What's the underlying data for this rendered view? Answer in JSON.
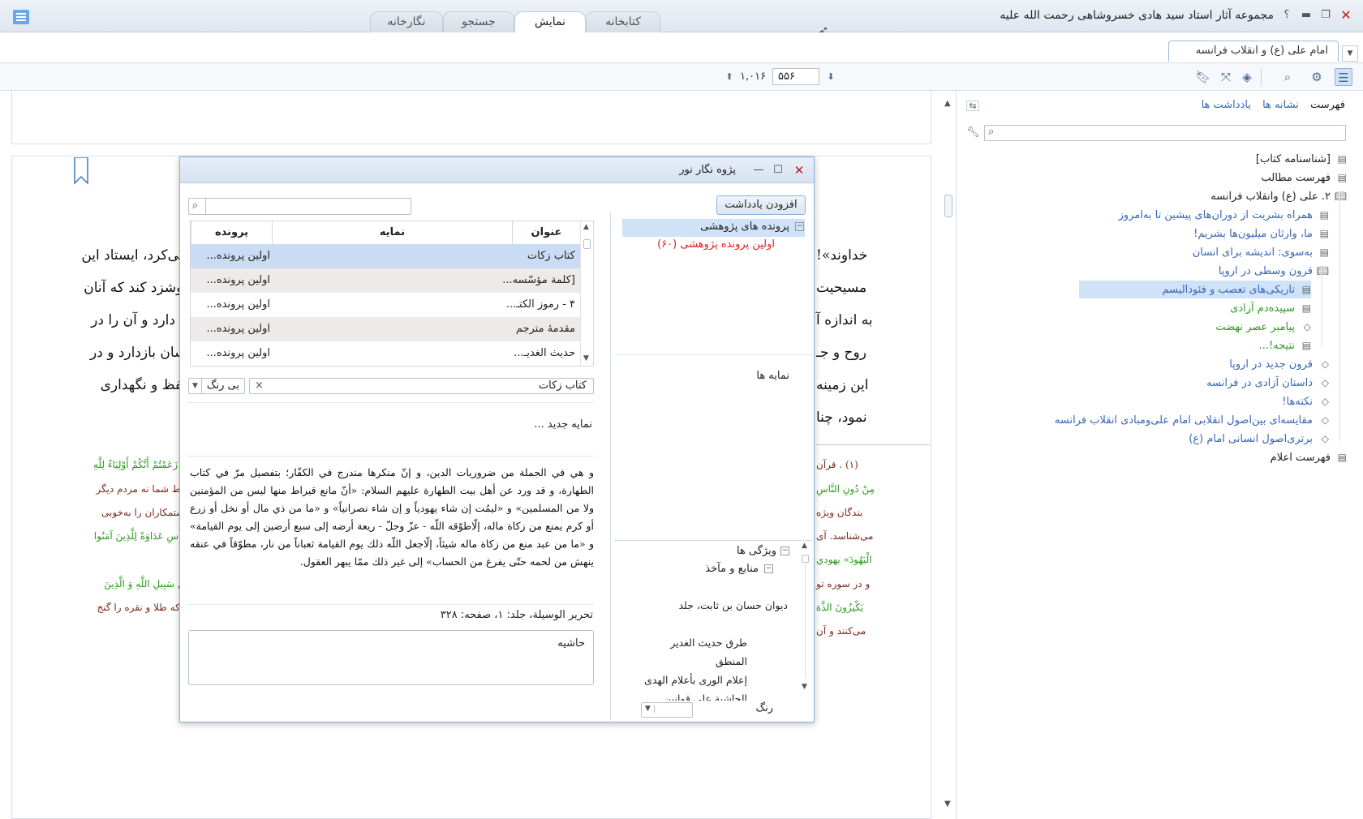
{
  "titlebar": {
    "title": "مجموعه آثار استاد سید هادی خسروشاهی رحمت الله علیه",
    "help": "؟",
    "tabs": [
      {
        "label": "کتابخانه",
        "active": false
      },
      {
        "label": "نمایش",
        "active": true
      },
      {
        "label": "جستجو",
        "active": false
      },
      {
        "label": "نگارخانه",
        "active": false
      }
    ]
  },
  "doc_tab": {
    "label": "امام علی (ع) و انقلاب فرانسه"
  },
  "toolbar": {
    "page_current": "۵۵۶",
    "page_total": "۱,۰۱۶"
  },
  "right_panel": {
    "tabs": [
      "فهرست",
      "نشانه ها",
      "یادداشت ها"
    ],
    "tree": [
      {
        "label": "[شناسنامه کتاب]",
        "color": "dark",
        "indent": 0,
        "icon": "doc-icon"
      },
      {
        "label": "فهرست مطالب",
        "color": "dark",
        "indent": 0,
        "icon": "doc-icon"
      },
      {
        "label": "۲. علی (ع) وانقلاب فرانسه",
        "color": "dark",
        "indent": 0,
        "icon": "book-icon"
      },
      {
        "label": "همراه بشریت از دوران‌های پیشین تا به‌امروز",
        "color": "blue",
        "indent": 1,
        "icon": "doc-icon"
      },
      {
        "label": "ما، وارثان میلیون‌ها بشریم!",
        "color": "blue",
        "indent": 1,
        "icon": "doc-icon"
      },
      {
        "label": "به‌سوی: اندیشه برای انسان",
        "color": "blue",
        "indent": 1,
        "icon": "doc-icon"
      },
      {
        "label": "قرون وسطی در اروپا",
        "color": "blue",
        "indent": 1,
        "icon": "book-icon"
      },
      {
        "label": "تاریکی‌های تعصب و فئودالیسم",
        "color": "blue",
        "indent": 2,
        "icon": "doc-icon",
        "selected": true
      },
      {
        "label": "سپیده‌دم آزادی",
        "color": "green",
        "indent": 2,
        "icon": "doc-icon"
      },
      {
        "label": "پیامبر عصر نهضت",
        "color": "green",
        "indent": 2,
        "icon": "tag-icon"
      },
      {
        "label": "نتیجه!...",
        "color": "green",
        "indent": 2,
        "icon": "doc-icon"
      },
      {
        "label": "قرون جدید در اروپا",
        "color": "blue",
        "indent": 1,
        "icon": "tag-icon"
      },
      {
        "label": "داستان آزادی در فرانسه",
        "color": "blue",
        "indent": 1,
        "icon": "tag-icon"
      },
      {
        "label": "نکته‌ها!",
        "color": "blue",
        "indent": 1,
        "icon": "tag-icon"
      },
      {
        "label": "مقایسه‌ای بین‌اصول انقلابی امام علی‌ومبادی انقلاب فرانسه",
        "color": "blue",
        "indent": 1,
        "icon": "tag-icon"
      },
      {
        "label": "برتری‌اصول انسانی امام (ع)",
        "color": "blue",
        "indent": 1,
        "icon": "tag-icon"
      },
      {
        "label": "فهرست اعلام",
        "color": "dark",
        "indent": 0,
        "icon": "doc-icon"
      }
    ]
  },
  "main_text": {
    "lines_left": [
      "سی‌کرد، ایستاد این",
      "موشزد کند که آنان",
      "اه دارد و آن را در",
      "نسان بازدارد و در",
      "حفظ و نگهداری"
    ],
    "lines_right": [
      "خداوند»!",
      "مسیحیت",
      "به اندازه آ",
      "روح و جـ",
      "این زمینه",
      "نمود، چنا"
    ],
    "footnotes_left": [
      {
        "text": "إِنْ زَعَمْتُمْ أَنَّكُمْ أَوْلِيَاءُ لِلَّهِ",
        "color": "green"
      },
      {
        "text": "فقط شما نه مردم دیگر",
        "color": "maroon"
      },
      {
        "text": "، ستمکاران را به‌خوبی",
        "color": "maroon"
      },
      {
        "text": "لِلنَّاسِ عَدَاوَةً لِلَّذِينَ آمَنُوا",
        "color": "green"
      },
      {
        "text": "عَنْ سَبِيلِ اللَّهِ وَ الَّذِينَ",
        "color": "green"
      },
      {
        "text": "ی که طلا و نقره را گنج",
        "color": "maroon"
      }
    ],
    "footnotes_right": [
      {
        "text": "(۱) . قرآن",
        "color": "maroon"
      },
      {
        "text": "مِنْ دُونِ النَّاسِ",
        "color": "green"
      },
      {
        "text": "بندگان ویژه",
        "color": "maroon"
      },
      {
        "text": "می‌شناسد. آی",
        "color": "maroon"
      },
      {
        "text": "الْيَهُودَ» يهودي",
        "color": "green"
      },
      {
        "text": "و در سوره تو",
        "color": "maroon"
      },
      {
        "text": "يَكْنِزُونَ الذَّهَ",
        "color": "green"
      },
      {
        "text": "می‌کنند و آن",
        "color": "maroon"
      }
    ]
  },
  "dialog": {
    "title": "پژوه نگار نور",
    "add_note": "افزودن یادداشت",
    "table": {
      "headers": [
        "عنوان",
        "نمایه",
        "پرونده پژوهشی"
      ],
      "rows": [
        {
          "title": "کتاب زکات",
          "index": "",
          "folder": "اولین پرونده..."
        },
        {
          "title": "[کلمة مؤسّسه...",
          "index": "",
          "folder": "اولین پرونده..."
        },
        {
          "title": "۴ - رموز الكتـ...",
          "index": "",
          "folder": "اولین پرونده..."
        },
        {
          "title": "مقدمهٔ مترجم",
          "index": "",
          "folder": "اولین پرونده..."
        },
        {
          "title": "حديث الغديـ...",
          "index": "",
          "folder": "اولین پرونده..."
        }
      ]
    },
    "folders_label": "پرونده های پژوهشی",
    "folder_item": "اولین پرونده پژوهشی (۶۰)",
    "index_label": "نمایه ها",
    "tag_value": "کتاب زکات",
    "color_value": "بی رنگ",
    "new_index": "نمایه جدید ...",
    "note_text": "و هي في الجملة من ضروريات الدين، و إنّ منكرها مندرج في الكفّار؛ بتفصيل مرّ في كتاب الطهارة، و قد ورد عن أهل بيت الطهارة عليهم السلام: «أنّ مانع قيراط منها ليس من المؤمنين ولا من المسلمين» و «ليمُت إن شاء يهودياً و إن شاء نصرانياً» و «ما من ذي مال أو نخل أو زرع أو كرم يمنع من زكاة ماله، إلّاطوّقه اللّه - عزّ وجلّ - ريعة أرضه إلى سبع أرضين إلى يوم القيامة» و «ما من عبد منع من زكاة ماله شيئاً، إلّاجعل اللّه ذلك يوم القيامة ثعباناً من نار، مطوّقاً في عنقه ينهش من لحمه حتّى يفرغ من الحساب» إلى غير ذلك ممّا يبهر العقول.",
    "source": "تحرير الوسيلة، جلد: ۱، صفحه: ۳۲۸",
    "hashiya": "حاشیه",
    "features_label": "ویژگی ها",
    "sources_label": "منابع و مآخذ",
    "sources": [
      "دیوان حسان بن ثابت، جلد",
      "طرق حديث الغدير",
      "المنطق",
      "إعلام الورى بأعلام الهدى",
      "الحاشية على قوانين"
    ],
    "color_label": "رنگ"
  },
  "colors": {
    "accent": "#3766b5",
    "green": "#2b9a1f",
    "red": "#e02020",
    "selection": "#cfe2f7"
  }
}
